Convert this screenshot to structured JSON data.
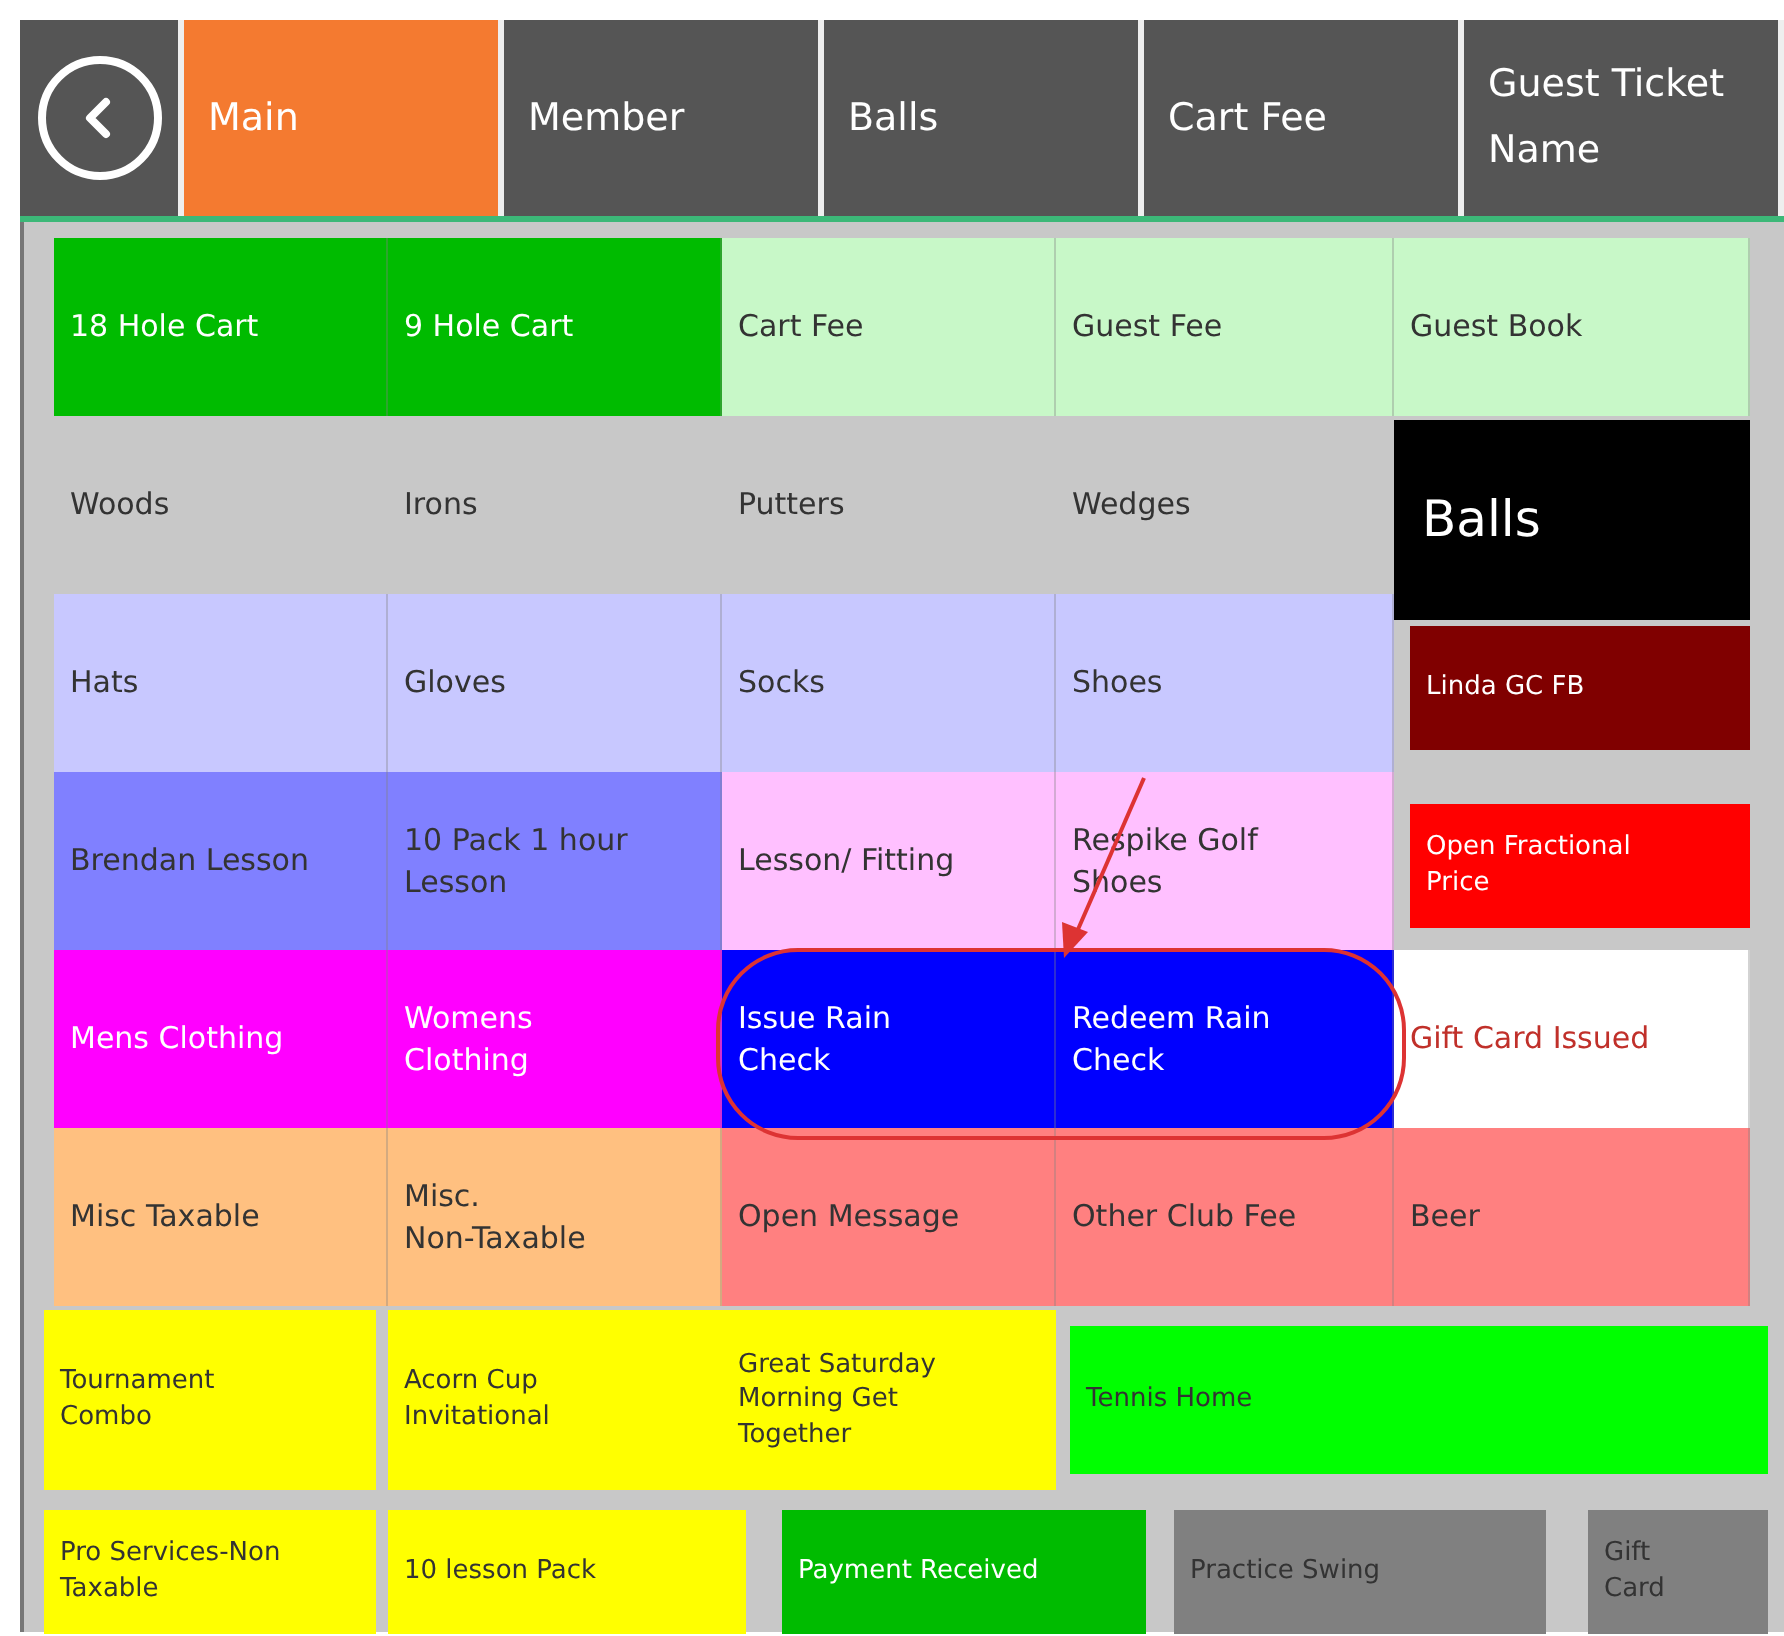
{
  "tabs": [
    {
      "label": "Main",
      "selected": true
    },
    {
      "label": "Member",
      "selected": false
    },
    {
      "label": "Balls",
      "selected": false
    },
    {
      "label": "Cart Fee",
      "selected": false
    },
    {
      "label": "Guest Ticket Name",
      "selected": false
    }
  ],
  "rows": [
    {
      "kind": "grid",
      "tiles": [
        {
          "label": "18 Hole Cart",
          "color": "#00bb00",
          "kind": "full"
        },
        {
          "label": "9 Hole Cart",
          "color": "#00bb00",
          "kind": "full"
        },
        {
          "label": "Cart Fee",
          "color": "#c8f8c8",
          "kind": "full"
        },
        {
          "label": "Guest Fee",
          "color": "#c8f8c8",
          "kind": "full"
        },
        {
          "label": "Guest Book",
          "color": "#c8f8c8",
          "kind": "full"
        }
      ]
    },
    {
      "kind": "grid",
      "tiles": [
        {
          "label": "Woods",
          "kind": "plain"
        },
        {
          "label": "Irons",
          "kind": "plain"
        },
        {
          "label": "Putters",
          "kind": "plain"
        },
        {
          "label": "Wedges",
          "kind": "plain"
        },
        {
          "label": "Balls",
          "color": "#000000",
          "kind": "large"
        }
      ]
    },
    {
      "kind": "grid",
      "tiles": [
        {
          "label": "Hats",
          "color": "#c8c8ff",
          "kind": "full"
        },
        {
          "label": "Gloves",
          "color": "#c8c8ff",
          "kind": "full"
        },
        {
          "label": "Socks",
          "color": "#c8c8ff",
          "kind": "full"
        },
        {
          "label": "Shoes",
          "color": "#c8c8ff",
          "kind": "full"
        },
        {
          "label": "Linda GC FB",
          "color": "#800000",
          "kind": "inset"
        }
      ]
    },
    {
      "kind": "grid",
      "tiles": [
        {
          "label": "Brendan Lesson",
          "color": "#8080ff",
          "kind": "full"
        },
        {
          "label": "10 Pack 1 hour Lesson",
          "color": "#8080ff",
          "kind": "full"
        },
        {
          "label": "Lesson/ Fitting",
          "color": "#ffc0ff",
          "kind": "full"
        },
        {
          "label": "Respike Golf Shoes",
          "color": "#ffc0ff",
          "kind": "full"
        },
        {
          "label": "Open Fractional Price",
          "color": "#ff0000",
          "kind": "inset"
        }
      ]
    },
    {
      "kind": "grid",
      "tiles": [
        {
          "label": "Mens Clothing",
          "color": "#ff00ff",
          "kind": "full"
        },
        {
          "label": "Womens Clothing",
          "color": "#ff00ff",
          "kind": "full"
        },
        {
          "label": "Issue Rain Check",
          "color": "#0000ff",
          "kind": "full"
        },
        {
          "label": "Redeem Rain Check",
          "color": "#0000ff",
          "kind": "full"
        },
        {
          "label": "Gift Card Issued",
          "color": "#ffffff",
          "kind": "accent"
        }
      ]
    },
    {
      "kind": "grid",
      "tiles": [
        {
          "label": "Misc Taxable",
          "color": "#ffc080",
          "kind": "full"
        },
        {
          "label": "Misc.\nNon-Taxable",
          "color": "#ffc080",
          "kind": "full"
        },
        {
          "label": "Open Message",
          "color": "#ff8080",
          "kind": "full"
        },
        {
          "label": "Other Club Fee",
          "color": "#ff8080",
          "kind": "full"
        },
        {
          "label": "Beer",
          "color": "#ff8080",
          "kind": "full"
        }
      ]
    },
    {
      "kind": "strip",
      "tiles": [
        {
          "label": "Tournament Combo",
          "color": "#ffff00",
          "kind": "full"
        },
        {
          "label": "Acorn Cup Invitational",
          "color": "#ffff00",
          "kind": "full"
        },
        {
          "label": "Great Saturday Morning Get Together",
          "color": "#ffff00",
          "kind": "full"
        },
        {
          "label": "Tennis Home",
          "color": "#00ff00",
          "kind": "inset"
        }
      ]
    },
    {
      "kind": "strip",
      "tiles": [
        {
          "label": "Pro Services-Non Taxable",
          "color": "#ffff00",
          "kind": "full"
        },
        {
          "label": "10 lesson Pack",
          "color": "#ffff00",
          "kind": "full"
        },
        {
          "label": "Payment Received",
          "color": "#00bb00",
          "kind": "full"
        },
        {
          "label": "Practice Swing",
          "color": "#808080",
          "kind": "full"
        },
        {
          "label": "Gift Card",
          "color": "#808080",
          "kind": "full"
        }
      ]
    }
  ]
}
